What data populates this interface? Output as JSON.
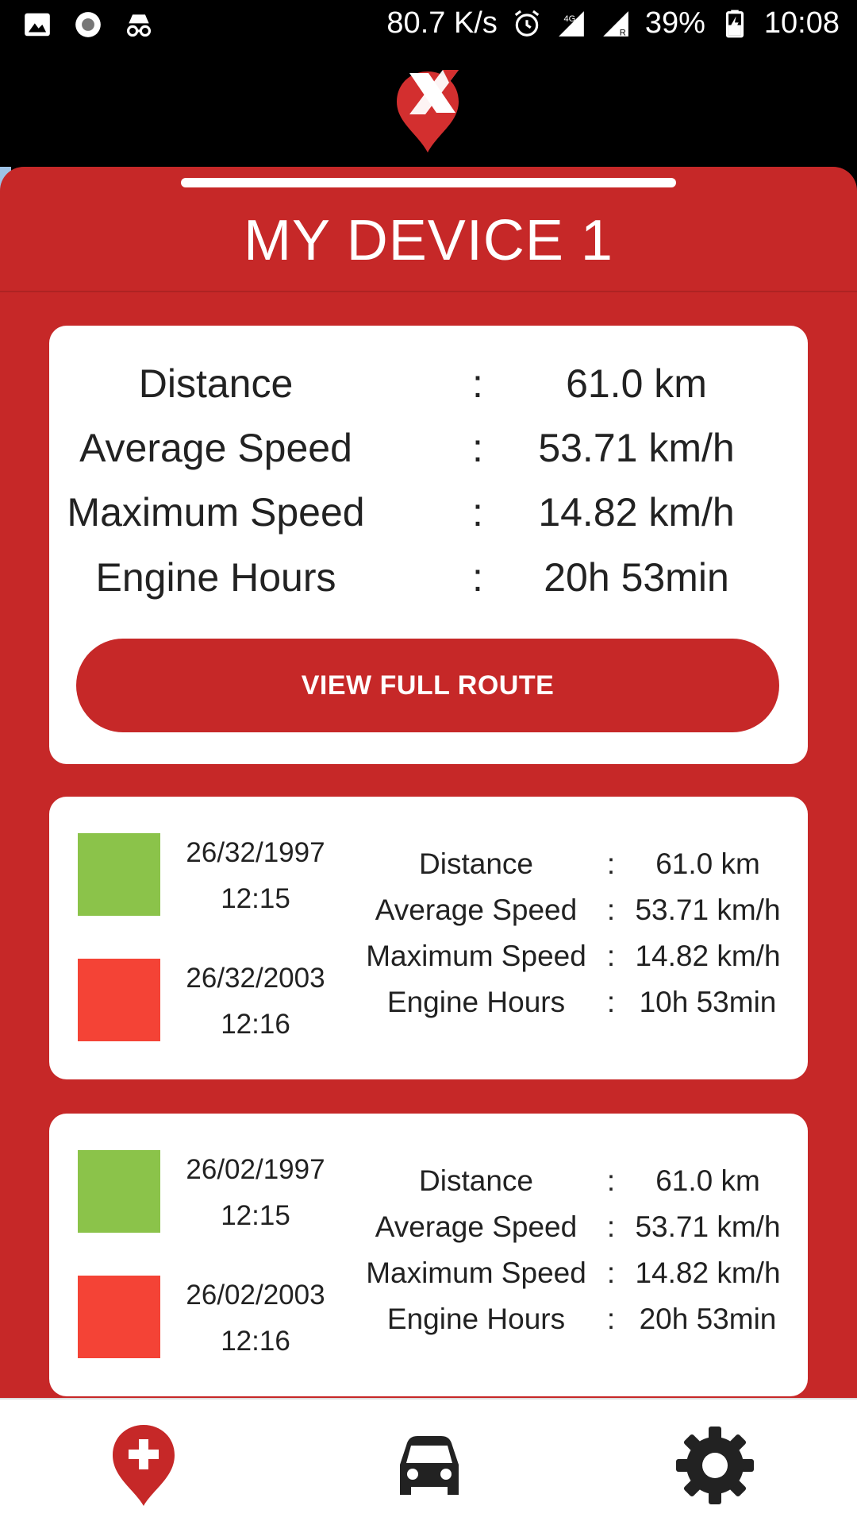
{
  "status_bar": {
    "network_speed": "80.7 K/s",
    "battery": "39%",
    "time": "10:08",
    "icons": [
      "image-icon",
      "record-icon",
      "incognito-icon",
      "alarm-icon",
      "signal-4g-icon",
      "signal-roaming-icon",
      "battery-charging-icon"
    ]
  },
  "app": {
    "logo": "app-logo-pin-icon",
    "device_title": "MY DEVICE 1"
  },
  "summary": {
    "rows": [
      {
        "label": "Distance",
        "sep": ":",
        "value": "61.0 km"
      },
      {
        "label": "Average Speed",
        "sep": ":",
        "value": "53.71 km/h"
      },
      {
        "label": "Maximum Speed",
        "sep": ":",
        "value": "14.82 km/h"
      },
      {
        "label": "Engine Hours",
        "sep": ":",
        "value": "20h 53min"
      }
    ],
    "button_label": "VIEW FULL ROUTE"
  },
  "trips": [
    {
      "start_date": "26/32/1997",
      "start_time": "12:15",
      "end_date": "26/32/2003",
      "end_time": "12:16",
      "rows": [
        {
          "label": "Distance",
          "sep": ":",
          "value": "61.0 km"
        },
        {
          "label": "Average Speed",
          "sep": ":",
          "value": "53.71 km/h"
        },
        {
          "label": "Maximum Speed",
          "sep": ":",
          "value": "14.82 km/h"
        },
        {
          "label": "Engine Hours",
          "sep": ":",
          "value": "10h 53min"
        }
      ]
    },
    {
      "start_date": "26/02/1997",
      "start_time": "12:15",
      "end_date": "26/02/2003",
      "end_time": "12:16",
      "rows": [
        {
          "label": "Distance",
          "sep": ":",
          "value": "61.0 km"
        },
        {
          "label": "Average Speed",
          "sep": ":",
          "value": "53.71 km/h"
        },
        {
          "label": "Maximum Speed",
          "sep": ":",
          "value": "14.82 km/h"
        },
        {
          "label": "Engine Hours",
          "sep": ":",
          "value": "20h 53min"
        }
      ]
    }
  ],
  "bottom_nav": [
    "location-pin-add-icon",
    "car-icon",
    "gear-icon"
  ],
  "colors": {
    "primary": "#c62828",
    "start_marker": "#8bc34a",
    "end_marker": "#f44336",
    "text": "#222222"
  }
}
